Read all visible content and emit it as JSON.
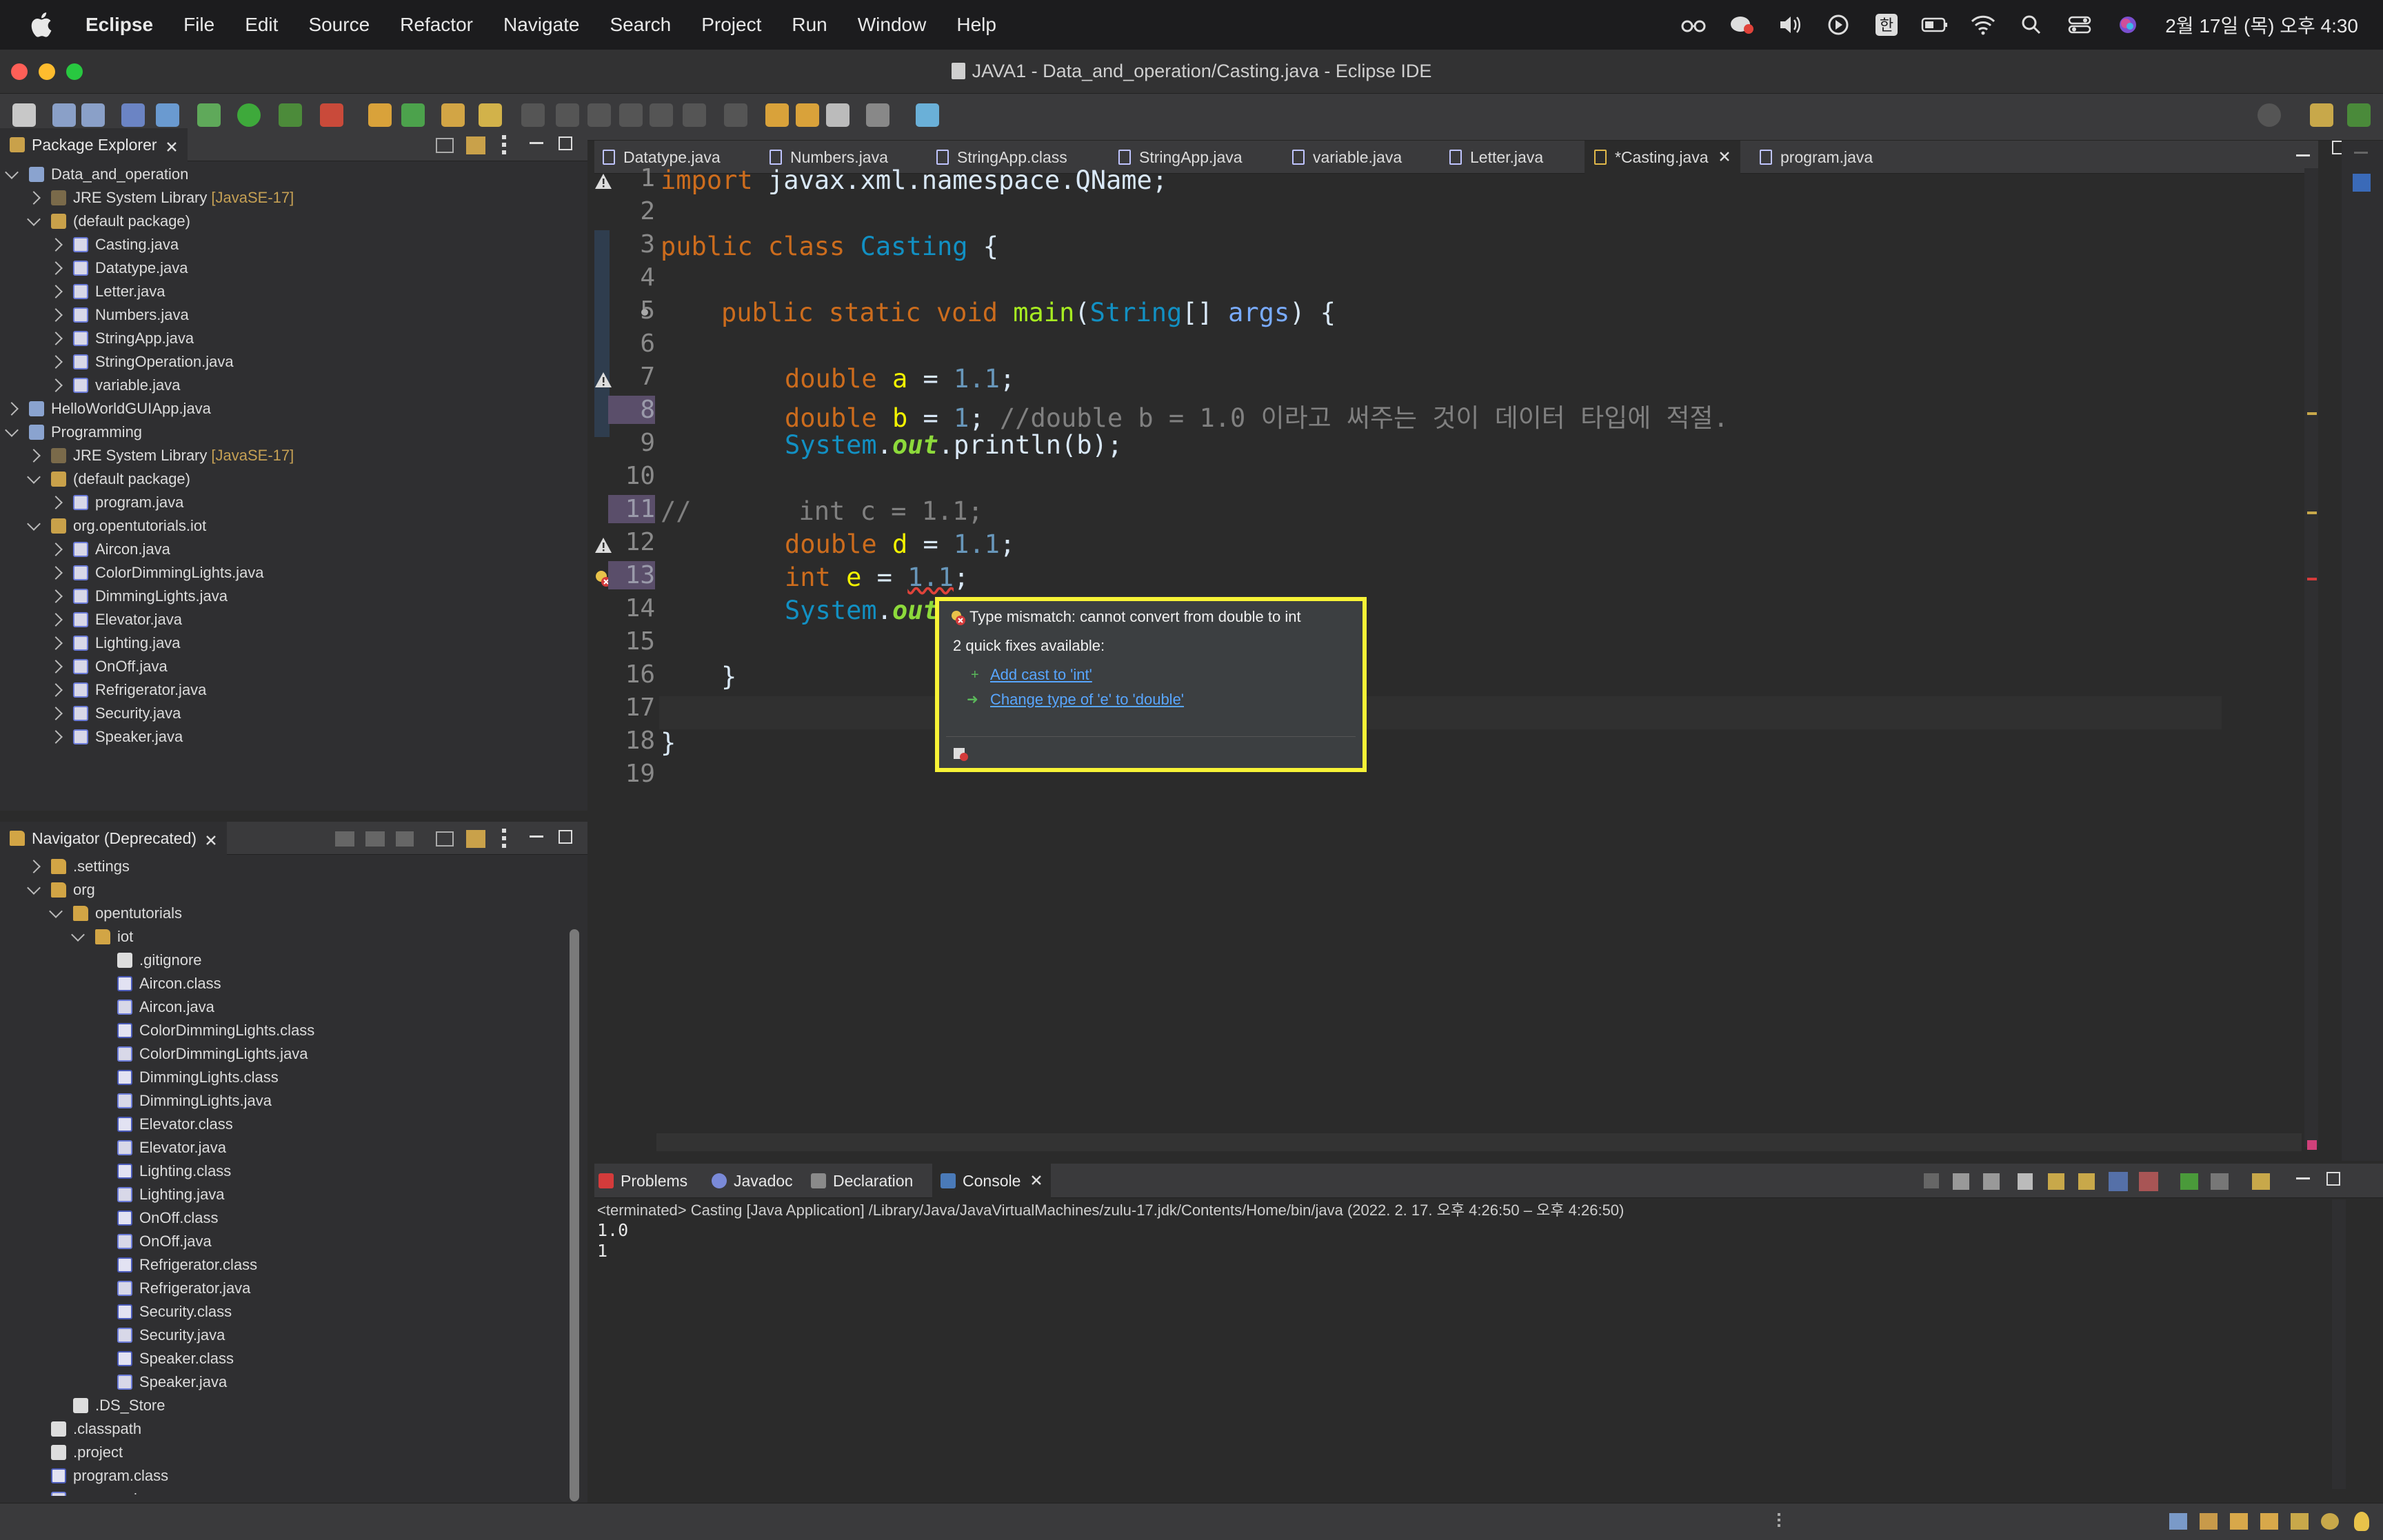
{
  "menubar": {
    "app": "Eclipse",
    "items": [
      "File",
      "Edit",
      "Source",
      "Refactor",
      "Navigate",
      "Search",
      "Project",
      "Run",
      "Window",
      "Help"
    ],
    "ime": "한",
    "clock": "2월 17일 (목) 오후 4:30"
  },
  "window": {
    "title": "JAVA1 - Data_and_operation/Casting.java - Eclipse IDE"
  },
  "package_explorer": {
    "title": "Package Explorer",
    "items": [
      {
        "label": "Data_and_operation",
        "level": 0,
        "icon": "proj",
        "chev": "d"
      },
      {
        "label": "JRE System Library",
        "tag": "[JavaSE-17]",
        "level": 1,
        "icon": "lib",
        "chev": "r"
      },
      {
        "label": "(default package)",
        "level": 1,
        "icon": "pkg",
        "chev": "d"
      },
      {
        "label": "Casting.java",
        "level": 2,
        "icon": "java",
        "chev": "r"
      },
      {
        "label": "Datatype.java",
        "level": 2,
        "icon": "java",
        "chev": "r"
      },
      {
        "label": "Letter.java",
        "level": 2,
        "icon": "java",
        "chev": "r"
      },
      {
        "label": "Numbers.java",
        "level": 2,
        "icon": "java",
        "chev": "r"
      },
      {
        "label": "StringApp.java",
        "level": 2,
        "icon": "java",
        "chev": "r"
      },
      {
        "label": "StringOperation.java",
        "level": 2,
        "icon": "java",
        "chev": "r"
      },
      {
        "label": "variable.java",
        "level": 2,
        "icon": "java",
        "chev": "r"
      },
      {
        "label": "HelloWorldGUIApp.java",
        "level": 0,
        "icon": "proj",
        "chev": "r"
      },
      {
        "label": "Programming",
        "level": 0,
        "icon": "proj",
        "chev": "d"
      },
      {
        "label": "JRE System Library",
        "tag": "[JavaSE-17]",
        "level": 1,
        "icon": "lib",
        "chev": "r"
      },
      {
        "label": "(default package)",
        "level": 1,
        "icon": "pkg",
        "chev": "d"
      },
      {
        "label": "program.java",
        "level": 2,
        "icon": "java",
        "chev": "r"
      },
      {
        "label": "org.opentutorials.iot",
        "level": 1,
        "icon": "pkg",
        "chev": "d"
      },
      {
        "label": "Aircon.java",
        "level": 2,
        "icon": "java",
        "chev": "r"
      },
      {
        "label": "ColorDimmingLights.java",
        "level": 2,
        "icon": "java",
        "chev": "r"
      },
      {
        "label": "DimmingLights.java",
        "level": 2,
        "icon": "java",
        "chev": "r"
      },
      {
        "label": "Elevator.java",
        "level": 2,
        "icon": "java",
        "chev": "r"
      },
      {
        "label": "Lighting.java",
        "level": 2,
        "icon": "java",
        "chev": "r"
      },
      {
        "label": "OnOff.java",
        "level": 2,
        "icon": "java",
        "chev": "r"
      },
      {
        "label": "Refrigerator.java",
        "level": 2,
        "icon": "java",
        "chev": "r"
      },
      {
        "label": "Security.java",
        "level": 2,
        "icon": "java",
        "chev": "r"
      },
      {
        "label": "Speaker.java",
        "level": 2,
        "icon": "java",
        "chev": "r"
      }
    ]
  },
  "navigator": {
    "title": "Navigator (Deprecated)",
    "items": [
      {
        "label": ".settings",
        "level": 1,
        "icon": "folder",
        "chev": "r"
      },
      {
        "label": "org",
        "level": 1,
        "icon": "folder",
        "chev": "d"
      },
      {
        "label": "opentutorials",
        "level": 2,
        "icon": "folder",
        "chev": "d"
      },
      {
        "label": "iot",
        "level": 3,
        "icon": "folder",
        "chev": "d"
      },
      {
        "label": ".gitignore",
        "level": 4,
        "icon": "file",
        "chev": "n"
      },
      {
        "label": "Aircon.class",
        "level": 4,
        "icon": "cls",
        "chev": "n"
      },
      {
        "label": "Aircon.java",
        "level": 4,
        "icon": "java",
        "chev": "n"
      },
      {
        "label": "ColorDimmingLights.class",
        "level": 4,
        "icon": "cls",
        "chev": "n"
      },
      {
        "label": "ColorDimmingLights.java",
        "level": 4,
        "icon": "java",
        "chev": "n"
      },
      {
        "label": "DimmingLights.class",
        "level": 4,
        "icon": "cls",
        "chev": "n"
      },
      {
        "label": "DimmingLights.java",
        "level": 4,
        "icon": "java",
        "chev": "n"
      },
      {
        "label": "Elevator.class",
        "level": 4,
        "icon": "cls",
        "chev": "n"
      },
      {
        "label": "Elevator.java",
        "level": 4,
        "icon": "java",
        "chev": "n"
      },
      {
        "label": "Lighting.class",
        "level": 4,
        "icon": "cls",
        "chev": "n"
      },
      {
        "label": "Lighting.java",
        "level": 4,
        "icon": "java",
        "chev": "n"
      },
      {
        "label": "OnOff.class",
        "level": 4,
        "icon": "cls",
        "chev": "n"
      },
      {
        "label": "OnOff.java",
        "level": 4,
        "icon": "java",
        "chev": "n"
      },
      {
        "label": "Refrigerator.class",
        "level": 4,
        "icon": "cls",
        "chev": "n"
      },
      {
        "label": "Refrigerator.java",
        "level": 4,
        "icon": "java",
        "chev": "n"
      },
      {
        "label": "Security.class",
        "level": 4,
        "icon": "cls",
        "chev": "n"
      },
      {
        "label": "Security.java",
        "level": 4,
        "icon": "java",
        "chev": "n"
      },
      {
        "label": "Speaker.class",
        "level": 4,
        "icon": "cls",
        "chev": "n"
      },
      {
        "label": "Speaker.java",
        "level": 4,
        "icon": "java",
        "chev": "n"
      },
      {
        "label": ".DS_Store",
        "level": 2,
        "icon": "file",
        "chev": "n"
      },
      {
        "label": ".classpath",
        "level": 1,
        "icon": "file",
        "chev": "n"
      },
      {
        "label": ".project",
        "level": 1,
        "icon": "file",
        "chev": "n"
      },
      {
        "label": "program.class",
        "level": 1,
        "icon": "cls",
        "chev": "n"
      },
      {
        "label": "program.java",
        "level": 1,
        "icon": "java",
        "chev": "n"
      }
    ]
  },
  "editor": {
    "tabs": [
      {
        "label": "Datatype.java"
      },
      {
        "label": "Numbers.java"
      },
      {
        "label": "StringApp.class"
      },
      {
        "label": "StringApp.java"
      },
      {
        "label": "variable.java"
      },
      {
        "label": "Letter.java"
      },
      {
        "label": "*Casting.java",
        "active": true
      },
      {
        "label": "program.java"
      }
    ],
    "line_numbers": [
      "1",
      "2",
      "3",
      "4",
      "5",
      "6",
      "7",
      "8",
      "9",
      "10",
      "11",
      "12",
      "13",
      "14",
      "15",
      "16",
      "17",
      "18",
      "19"
    ],
    "lines": {
      "l1_kw": "import",
      "l1_rest": " javax.xml.namespace.QName;",
      "l3_kw": "public class",
      "l3_name": "Casting",
      "l3_rest": " {",
      "l5_kw": "public static void",
      "l5_fn": "main",
      "l5_open": "(",
      "l5_type": "String",
      "l5_mid": "[] ",
      "l5_arg": "args",
      "l5_rest": ") {",
      "l7_kw": "double",
      "l7_var": "a",
      "l7_eq": " = ",
      "l7_num": "1.1",
      "l7_end": ";",
      "l8_kw": "double",
      "l8_var": "b",
      "l8_eq": " = ",
      "l8_num": "1",
      "l8_end": "; ",
      "l8_comment": "//double b = 1.0 이라고 써주는 것이 데이터 타입에 적절.",
      "l9_sys": "System",
      "l9_dot": ".",
      "l9_out": "out",
      "l9_rest": ".println(b);",
      "l11_comment": "//       int c = 1.1;",
      "l12_kw": "double",
      "l12_var": "d",
      "l12_eq": " = ",
      "l12_num": "1.1",
      "l12_end": ";",
      "l13_kw": "int",
      "l13_var": "e",
      "l13_eq": " = ",
      "l13_num": "1.1",
      "l13_end": ";",
      "l14_sys": "System",
      "l14_dot": ".",
      "l14_out": "out",
      "l16": "}",
      "l18": "}"
    }
  },
  "popup": {
    "title": "Type mismatch: cannot convert from double to int",
    "subtitle": "2 quick fixes available:",
    "fixes": [
      "Add cast to 'int'",
      "Change type of 'e' to 'double'"
    ]
  },
  "console": {
    "tabs": [
      "Problems",
      "Javadoc",
      "Declaration",
      "Console"
    ],
    "terminated": "<terminated> Casting [Java Application] /Library/Java/JavaVirtualMachines/zulu-17.jdk/Contents/Home/bin/java  (2022. 2. 17. 오후 4:26:50 – 오후 4:26:50)",
    "output": [
      "1.0",
      "1"
    ]
  },
  "colors": {
    "accent_highlight": "#f7f336",
    "link": "#58a6ff",
    "keyword": "#cc6c1d",
    "type": "#1290c3"
  }
}
